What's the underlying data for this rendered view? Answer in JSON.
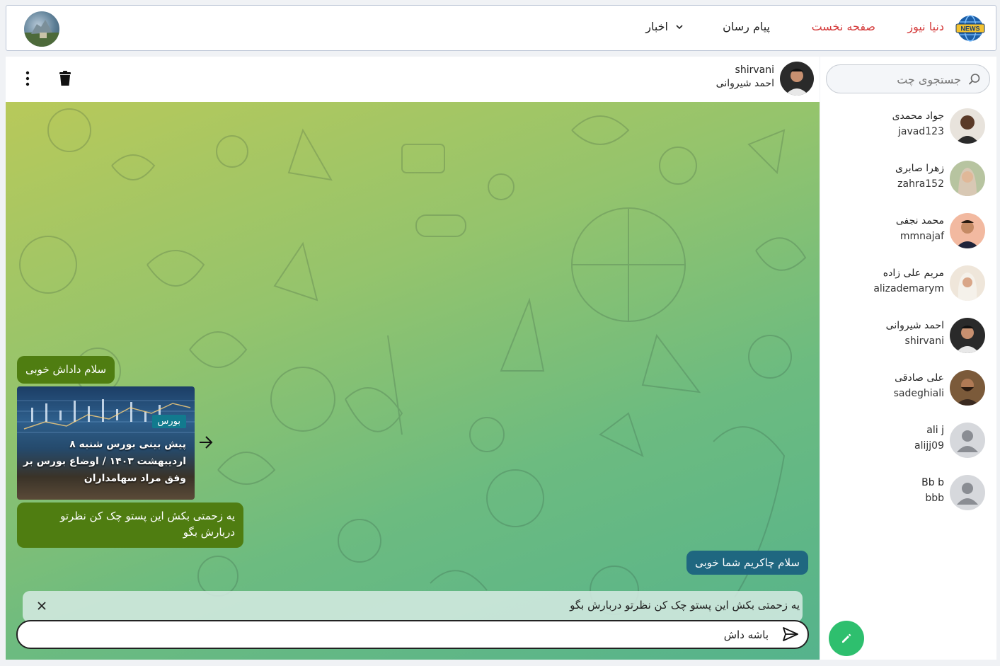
{
  "nav": {
    "brand": "دنیا نیوز",
    "home": "صفحه نخست",
    "messenger": "پیام رسان",
    "news": "اخبار",
    "logo_badge": "NEWS"
  },
  "sidebar": {
    "search_placeholder": "جستجوی چت",
    "contacts": [
      {
        "name": "جواد محمدی",
        "username": "javad123"
      },
      {
        "name": "زهرا صابری",
        "username": "zahra152"
      },
      {
        "name": "محمد نجفی",
        "username": "mmnajaf"
      },
      {
        "name": "مریم علی زاده",
        "username": "alizademarym"
      },
      {
        "name": "احمد شیروانی",
        "username": "shirvani"
      },
      {
        "name": "علی صادقی",
        "username": "sadeghiali"
      },
      {
        "name": "ali j",
        "username": "alijj09"
      },
      {
        "name": "Bb b",
        "username": "bbb"
      }
    ]
  },
  "chat": {
    "header": {
      "username": "shirvani",
      "name": "احمد شیروانی"
    },
    "messages": {
      "greeting_in": "سلام داداش خوبی",
      "news_badge": "بورس",
      "news_title": "پیش بینی بورس شنبه ۸ اردیبهشت ۱۴۰۳ / اوضاع بورس بر وفق مراد سهامداران",
      "request_in_line1": "یه زحمتی بکش این پستو چک کن نظرتو",
      "request_in_line2": "دربارش بگو",
      "reply_out": "سلام چاکریم شما خوبی"
    },
    "reply_preview": "یه زحمتی بکش این پستو چک کن نظرتو دربارش بگو",
    "input_value": "باشه داش"
  }
}
